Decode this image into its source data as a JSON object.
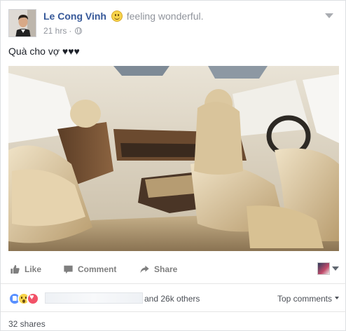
{
  "post": {
    "author": "Le Cong Vinh",
    "feeling": "feeling wonderful.",
    "time": "21 hrs",
    "separator": "·",
    "text": "Quà cho vợ ♥♥♥"
  },
  "icons": {
    "feeling": "smile-emoji-icon",
    "privacy": "globe-icon",
    "options": "chevron-down-icon",
    "like": "thumbs-up-icon",
    "comment": "speech-bubble-icon",
    "share": "share-arrow-icon"
  },
  "actions": {
    "like": "Like",
    "comment": "Comment",
    "share": "Share"
  },
  "reactions": {
    "types": [
      "like",
      "wow",
      "love"
    ],
    "others": "and 26k others",
    "sort": "Top comments"
  },
  "shares": "32 shares",
  "colors": {
    "name": "#365899",
    "secondary_text": "#90949c",
    "like_blue": "#5890ff",
    "love_red": "#f25268",
    "wow_yellow": "#f7d44c"
  }
}
